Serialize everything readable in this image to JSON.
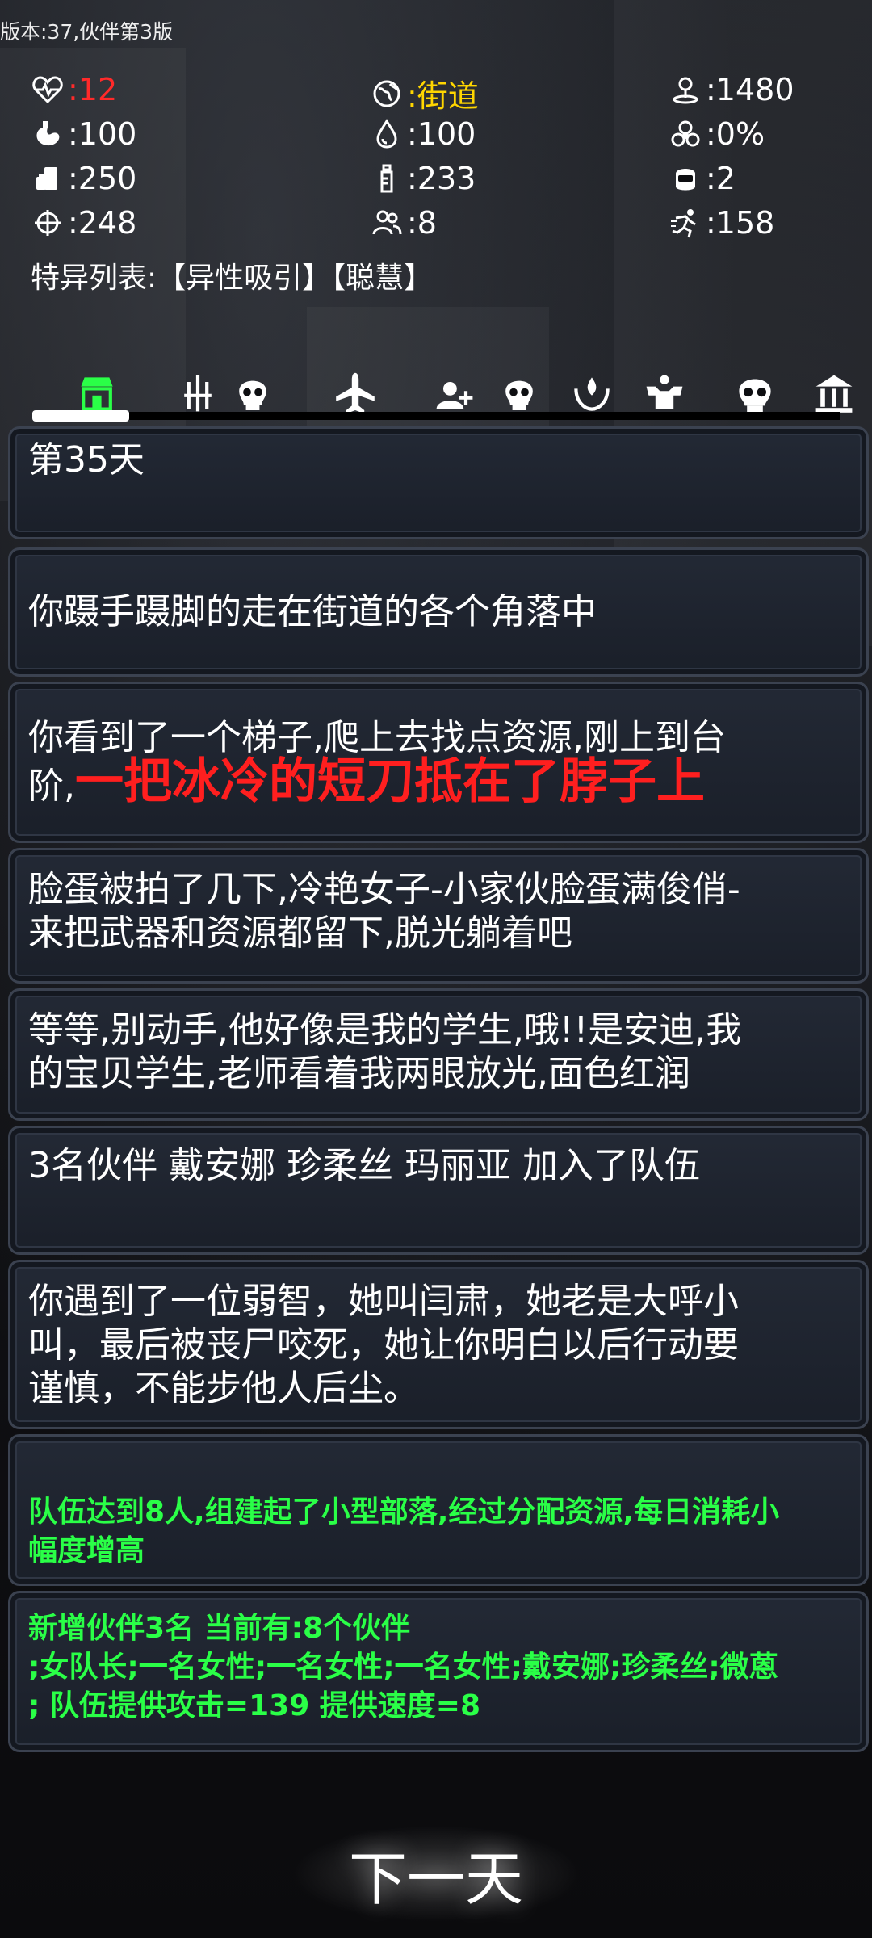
{
  "version": "版本:37,伙伴第3版",
  "stats": {
    "health": ":12",
    "location": ":街道",
    "distance": ":1480",
    "hunger": ":100",
    "water": ":100",
    "infection": ":0%",
    "food": ":250",
    "drink": ":233",
    "armor": ":2",
    "attack": ":248",
    "companions": ":8",
    "speed": ":158"
  },
  "specials": "特异列表:【异性吸引】【聪慧】",
  "tabs": [
    "shop",
    "weapons-skull",
    "travel",
    "add-friend",
    "skull",
    "camp",
    "strength",
    "boss-skull",
    "bank"
  ],
  "log": {
    "p1": "第35天",
    "p2": "你蹑手蹑脚的走在街道的各个角落中",
    "p3a": "你看到了一个梯子,爬上去找点资源,刚上到台",
    "p3b": "阶,",
    "p3c": "一把冰冷的短刀抵在了脖子上",
    "p4a": "脸蛋被拍了几下,冷艳女子-小家伙脸蛋满俊俏-",
    "p4b": "来把武器和资源都留下,脱光躺着吧",
    "p5a": "等等,别动手,他好像是我的学生,哦!!是安迪,我",
    "p5b": "的宝贝学生,老师看着我两眼放光,面色红润",
    "p6": "3名伙伴 戴安娜 珍柔丝 玛丽亚 加入了队伍",
    "p7a": "你遇到了一位弱智，她叫闫肃，她老是大呼小",
    "p7b": "叫，最后被丧尸咬死，她让你明白以后行动要",
    "p7c": "谨慎，不能步他人后尘。",
    "p8a": "队伍达到8人,组建起了小型部落,经过分配资源,每日消耗小",
    "p8b": "幅度增高",
    "p9a": "新增伙伴3名  当前有:8个伙伴",
    "p9b": ";女队长;一名女性;一名女性;一名女性;戴安娜;珍柔丝;微蒽",
    "p9c": ";  队伍提供攻击=139  提供速度=8"
  },
  "next_button": "下一天",
  "colors": {
    "accent_green": "#2aff47",
    "danger_red": "#ff1f1f",
    "location_yellow": "#ffd600"
  }
}
